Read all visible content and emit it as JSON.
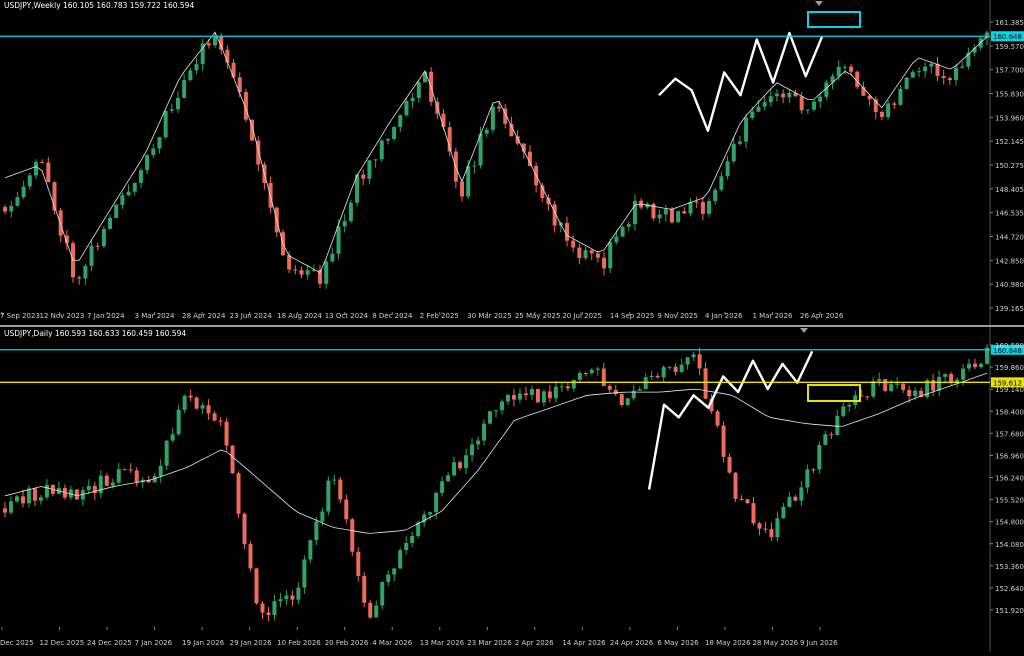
{
  "window": {
    "panes": [
      {
        "header": "USDJPY,Weekly  160.105 160.783 159.722 160.594"
      },
      {
        "header": "USDJPY,Daily  160.593 160.633 160.459 160.594"
      }
    ]
  },
  "colors": {
    "background": "#000000",
    "bull": "#2fa468",
    "bear": "#ef6a5a",
    "ma": "#e6e6e6",
    "trend": "#ffffff",
    "cyan": "#00d8e8",
    "yellow": "#e8e200",
    "axis_text": "#cfcfcf"
  },
  "chart_data": [
    {
      "type": "candlestick",
      "symbol": "USDJPY",
      "timeframe": "Weekly",
      "ohlc": {
        "open": 160.105,
        "high": 160.783,
        "low": 159.722,
        "close": 160.594
      },
      "ylim": [
        139.165,
        161.925
      ],
      "y_ticks": [
        "161.385",
        "159.570",
        "157.700",
        "155.830",
        "153.960",
        "152.145",
        "150.275",
        "148.405",
        "146.535",
        "144.720",
        "142.850",
        "140.980",
        "139.165"
      ],
      "x_ticks": [
        "7 Sep 2023",
        "12 Nov 2023",
        "7 Jan 2024",
        "3 Mar 2024",
        "28 Apr 2024",
        "23 Jun 2024",
        "18 Aug 2024",
        "13 Oct 2024",
        "8 Dec 2024",
        "2 Feb 2025",
        "30 Mar 2025",
        "25 May 2025",
        "20 Jul 2025",
        "14 Sep 2025",
        "9 Nov 2025",
        "4 Jan 2026",
        "1 Mar 2026",
        "26 Apr 2026"
      ],
      "price_lines": [
        {
          "label": "160.648",
          "value": 160.648,
          "color": "cyan"
        }
      ],
      "anchors": [
        [
          147.2,
          149.5
        ],
        [
          151.0,
          150.5
        ],
        [
          141.7,
          142.5
        ],
        [
          146.2,
          147.0
        ],
        [
          151.0,
          151.4
        ],
        [
          156.4,
          157.5
        ],
        [
          161.2,
          161.0
        ],
        [
          153.5,
          154.0
        ],
        [
          142.6,
          143.5
        ],
        [
          141.7,
          142.0
        ],
        [
          148.9,
          149.5
        ],
        [
          153.6,
          154.0
        ],
        [
          157.5,
          158.0
        ],
        [
          148.4,
          149.0
        ],
        [
          155.5,
          156.0
        ],
        [
          150.0,
          150.5
        ],
        [
          144.5,
          145.0
        ],
        [
          142.6,
          143.5
        ],
        [
          147.4,
          147.5
        ],
        [
          146.4,
          147.0
        ],
        [
          147.4,
          148.0
        ],
        [
          153.2,
          154.0
        ],
        [
          156.4,
          157.0
        ],
        [
          154.8,
          155.5
        ],
        [
          158.6,
          158.0
        ],
        [
          154.4,
          155.0
        ],
        [
          158.6,
          159.0
        ],
        [
          157.4,
          158.0
        ],
        [
          160.8,
          160.6
        ]
      ],
      "trend_path": [
        [
          156.0,
          157.5
        ],
        [
          157.3,
          157.7
        ],
        [
          156.4,
          157.8
        ],
        [
          153.2,
          157.9
        ],
        [
          157.8,
          158.0
        ],
        [
          156.0,
          158.3
        ],
        [
          160.4,
          158.5
        ],
        [
          157.0,
          158.6
        ],
        [
          160.9,
          158.9
        ],
        [
          157.5,
          159.0
        ],
        [
          160.6,
          159.2
        ]
      ]
    },
    {
      "type": "candlestick",
      "symbol": "USDJPY",
      "timeframe": "Daily",
      "ohlc": {
        "open": 160.593,
        "high": 160.633,
        "low": 160.459,
        "close": 160.594
      },
      "ylim": [
        151.92,
        160.8
      ],
      "y_ticks": [
        "160.580",
        "159.860",
        "159.140",
        "158.400",
        "157.680",
        "156.960",
        "156.240",
        "155.520",
        "154.800",
        "154.080",
        "153.360",
        "152.640",
        "151.920"
      ],
      "x_ticks": [
        "Dec 2025",
        "12 Dec 2025",
        "24 Dec 2025",
        "7 Jan 2026",
        "19 Jan 2026",
        "29 Jan 2026",
        "10 Feb 2026",
        "20 Feb 2026",
        "4 Mar 2026",
        "13 Mar 2026",
        "23 Mar 2026",
        "2 Apr 2026",
        "14 Apr 2026",
        "24 Apr 2026",
        "6 May 2026",
        "18 May 2026",
        "28 May 2026",
        "9 Jun 2026"
      ],
      "price_lines": [
        {
          "label": "160.648",
          "value": 160.648,
          "color": "cyan"
        },
        {
          "label": "159.612",
          "value": 159.612,
          "color": "yellow"
        }
      ],
      "anchors": [
        [
          155.6,
          156.0
        ],
        [
          156.2,
          156.3
        ],
        [
          155.9,
          156.0
        ],
        [
          156.7,
          156.3
        ],
        [
          156.4,
          156.5
        ],
        [
          159.1,
          156.9
        ],
        [
          158.3,
          157.5
        ],
        [
          152.1,
          156.5
        ],
        [
          153.0,
          155.5
        ],
        [
          156.8,
          155.0
        ],
        [
          152.2,
          154.8
        ],
        [
          154.5,
          154.9
        ],
        [
          156.2,
          155.5
        ],
        [
          158.0,
          156.8
        ],
        [
          159.3,
          158.4
        ],
        [
          159.1,
          158.8
        ],
        [
          160.2,
          159.2
        ],
        [
          159.1,
          159.3
        ],
        [
          159.8,
          159.3
        ],
        [
          160.4,
          159.4
        ],
        [
          156.3,
          159.2
        ],
        [
          154.7,
          158.5
        ],
        [
          156.5,
          158.3
        ],
        [
          158.8,
          158.2
        ],
        [
          159.5,
          158.6
        ],
        [
          159.3,
          159.1
        ],
        [
          159.8,
          159.5
        ],
        [
          160.5,
          159.9
        ]
      ],
      "trend_path": [
        [
          156.2,
          1.0
        ],
        [
          158.9,
          1.0
        ],
        [
          158.5,
          1.0
        ],
        [
          159.2,
          1.0
        ],
        [
          158.8,
          1.0
        ],
        [
          159.8,
          1.0
        ],
        [
          159.3,
          1.0
        ],
        [
          160.3,
          1.0
        ],
        [
          159.4,
          1.0
        ],
        [
          160.2,
          1.0
        ],
        [
          159.6,
          1.0
        ],
        [
          160.6,
          1.0
        ]
      ]
    }
  ]
}
